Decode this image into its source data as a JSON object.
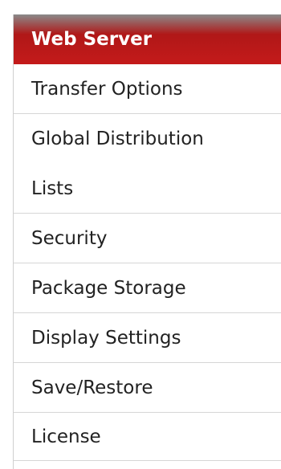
{
  "sidebar": {
    "items": [
      {
        "label": "Web Server",
        "active": true
      },
      {
        "label": "Transfer Options"
      },
      {
        "label": "Global Distribution"
      },
      {
        "label": "Lists"
      },
      {
        "label": "Security"
      },
      {
        "label": "Package Storage"
      },
      {
        "label": "Display Settings"
      },
      {
        "label": "Save/Restore"
      },
      {
        "label": "License"
      }
    ]
  },
  "colors": {
    "active_bg": "#c41a1a",
    "active_text": "#ffffff",
    "text": "#222222",
    "divider": "#d6d6d6"
  }
}
